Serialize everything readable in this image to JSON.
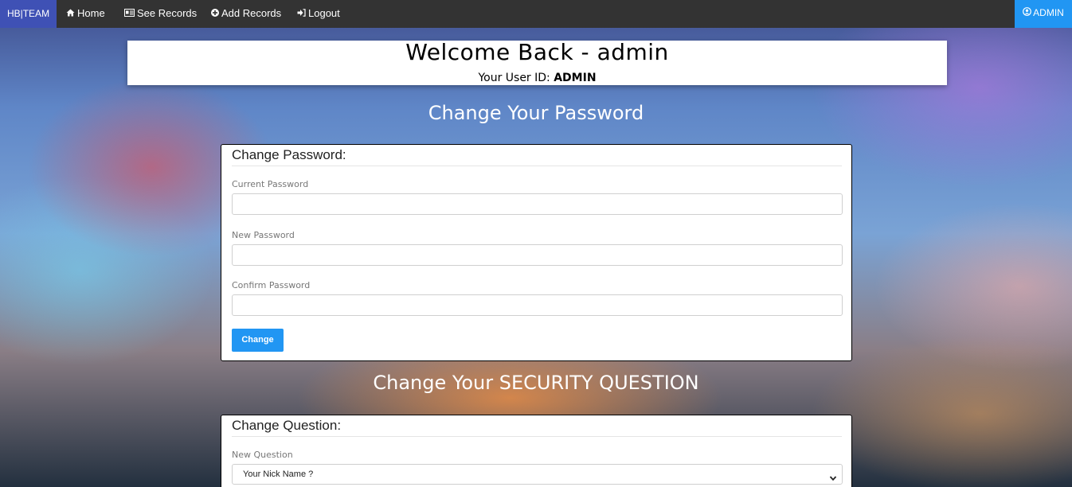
{
  "navbar": {
    "brand": "HB|TEAM",
    "items": [
      {
        "label": "Home",
        "icon": "home-icon"
      },
      {
        "label": "See Records",
        "icon": "id-card-icon"
      },
      {
        "label": "Add Records",
        "icon": "plus-circle-icon"
      },
      {
        "label": "Logout",
        "icon": "sign-in-icon"
      }
    ],
    "user": {
      "label": "ADMIN",
      "icon": "user-circle-icon"
    }
  },
  "welcome": {
    "title": "Welcome Back - admin",
    "user_id_label": "Your User ID:",
    "user_id_value": "ADMIN"
  },
  "password_section": {
    "heading": "Change Your Password",
    "legend": "Change Password:",
    "current_label": "Current Password",
    "current_value": "",
    "new_label": "New Password",
    "new_value": "",
    "confirm_label": "Confirm Password",
    "confirm_value": "",
    "button_label": "Change"
  },
  "question_section": {
    "heading": "Change Your SECURITY QUESTION",
    "legend": "Change Question:",
    "question_label": "New Question",
    "selected_question": "Your Nick Name ?"
  },
  "colors": {
    "navbar_bg": "#333333",
    "brand_bg": "#3f51b5",
    "accent": "#2196f3"
  }
}
